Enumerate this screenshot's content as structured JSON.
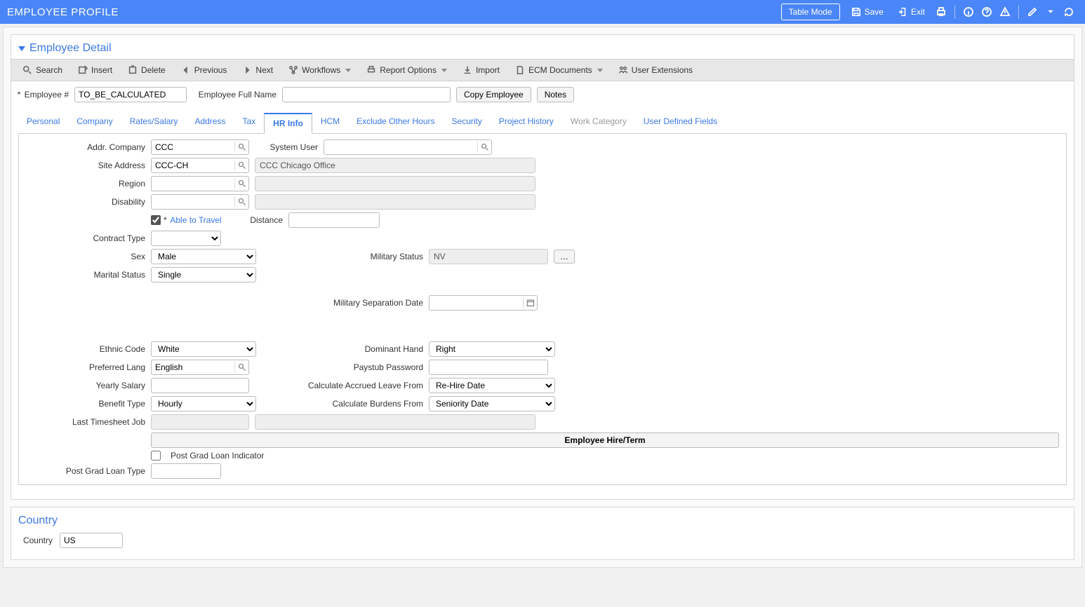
{
  "header": {
    "title": "EMPLOYEE PROFILE",
    "table_mode": "Table Mode",
    "save": "Save",
    "exit": "Exit"
  },
  "employeeDetail": {
    "heading": "Employee Detail",
    "toolbar": {
      "search": "Search",
      "insert": "Insert",
      "delete": "Delete",
      "previous": "Previous",
      "next": "Next",
      "workflows": "Workflows",
      "report_options": "Report Options",
      "import": "Import",
      "ecm_documents": "ECM Documents",
      "user_extensions": "User Extensions"
    },
    "fields": {
      "employee_num_label": "Employee #",
      "employee_num_value": "TO_BE_CALCULATED",
      "full_name_label": "Employee Full Name",
      "full_name_value": "",
      "copy_employee": "Copy Employee",
      "notes": "Notes"
    },
    "tabs": {
      "personal": "Personal",
      "company": "Company",
      "rates": "Rates/Salary",
      "address": "Address",
      "tax": "Tax",
      "hrinfo": "HR Info",
      "hcm": "HCM",
      "exclude": "Exclude Other Hours",
      "security": "Security",
      "project": "Project History",
      "workcat": "Work Category",
      "udf": "User Defined Fields"
    },
    "hrinfo": {
      "addr_company_label": "Addr. Company",
      "addr_company_value": "CCC",
      "system_user_label": "System User",
      "system_user_value": "",
      "site_address_label": "Site Address",
      "site_address_value": "CCC-CH",
      "site_address_desc": "CCC Chicago Office",
      "region_label": "Region",
      "region_value": "",
      "disability_label": "Disability",
      "disability_value": "",
      "able_to_travel_label": "Able to Travel",
      "able_to_travel_checked": true,
      "distance_label": "Distance",
      "distance_value": "",
      "contract_type_label": "Contract Type",
      "contract_type_value": "",
      "sex_label": "Sex",
      "sex_value": "Male",
      "military_status_label": "Military Status",
      "military_status_value": "NV",
      "marital_label": "Marital Status",
      "marital_value": "Single",
      "mil_sep_date_label": "Military Separation Date",
      "mil_sep_date_value": "",
      "ethnic_label": "Ethnic Code",
      "ethnic_value": "White",
      "dominant_hand_label": "Dominant Hand",
      "dominant_hand_value": "Right",
      "pref_lang_label": "Preferred Lang",
      "pref_lang_value": "English",
      "paystub_pw_label": "Paystub Password",
      "paystub_pw_value": "",
      "yearly_salary_label": "Yearly Salary",
      "yearly_salary_value": "",
      "accrued_leave_label": "Calculate Accrued Leave From",
      "accrued_leave_value": "Re-Hire Date",
      "benefit_type_label": "Benefit Type",
      "benefit_type_value": "Hourly",
      "burdens_label": "Calculate Burdens From",
      "burdens_value": "Seniority Date",
      "last_timesheet_label": "Last Timesheet Job",
      "hire_term_btn": "Employee Hire/Term",
      "post_grad_check_label": "Post Grad Loan Indicator",
      "post_grad_type_label": "Post Grad Loan Type",
      "post_grad_type_value": ""
    }
  },
  "country": {
    "heading": "Country",
    "label": "Country",
    "value": "US"
  }
}
